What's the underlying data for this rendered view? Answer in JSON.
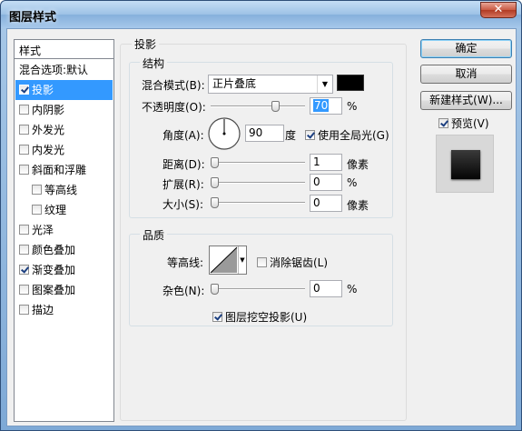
{
  "window": {
    "title": "图层样式",
    "close_glyph": "✕"
  },
  "sidebar": {
    "header": "样式",
    "items": [
      {
        "label": "混合选项:默认",
        "checkbox": false,
        "checked": false,
        "indent": false,
        "selected": false
      },
      {
        "label": "投影",
        "checkbox": true,
        "checked": true,
        "indent": false,
        "selected": true
      },
      {
        "label": "内阴影",
        "checkbox": true,
        "checked": false,
        "indent": false,
        "selected": false
      },
      {
        "label": "外发光",
        "checkbox": true,
        "checked": false,
        "indent": false,
        "selected": false
      },
      {
        "label": "内发光",
        "checkbox": true,
        "checked": false,
        "indent": false,
        "selected": false
      },
      {
        "label": "斜面和浮雕",
        "checkbox": true,
        "checked": false,
        "indent": false,
        "selected": false
      },
      {
        "label": "等高线",
        "checkbox": true,
        "checked": false,
        "indent": true,
        "selected": false
      },
      {
        "label": "纹理",
        "checkbox": true,
        "checked": false,
        "indent": true,
        "selected": false
      },
      {
        "label": "光泽",
        "checkbox": true,
        "checked": false,
        "indent": false,
        "selected": false
      },
      {
        "label": "颜色叠加",
        "checkbox": true,
        "checked": false,
        "indent": false,
        "selected": false
      },
      {
        "label": "渐变叠加",
        "checkbox": true,
        "checked": true,
        "indent": false,
        "selected": false
      },
      {
        "label": "图案叠加",
        "checkbox": true,
        "checked": false,
        "indent": false,
        "selected": false
      },
      {
        "label": "描边",
        "checkbox": true,
        "checked": false,
        "indent": false,
        "selected": false
      }
    ]
  },
  "shadow": {
    "group_label": "投影",
    "structure": {
      "label": "结构",
      "blend_mode_label": "混合模式(B):",
      "blend_mode_value": "正片叠底",
      "blend_color": "#000000",
      "opacity_label": "不透明度(O):",
      "opacity_value": "70",
      "opacity_unit": "%",
      "opacity_level": 0.7,
      "angle_label": "角度(A):",
      "angle_value": "90",
      "angle_unit": "度",
      "global_light_label": "使用全局光(G)",
      "global_light_checked": true,
      "distance_label": "距离(D):",
      "distance_value": "1",
      "distance_unit": "像素",
      "distance_level": 0.0,
      "spread_label": "扩展(R):",
      "spread_value": "0",
      "spread_unit": "%",
      "spread_level": 0.0,
      "size_label": "大小(S):",
      "size_value": "0",
      "size_unit": "像素",
      "size_level": 0.0
    },
    "quality": {
      "label": "品质",
      "contour_label": "等高线:",
      "antialias_label": "消除锯齿(L)",
      "antialias_checked": false,
      "noise_label": "杂色(N):",
      "noise_value": "0",
      "noise_unit": "%",
      "noise_level": 0.0
    },
    "knockout_label": "图层挖空投影(U)",
    "knockout_checked": true
  },
  "buttons": {
    "ok": "确定",
    "cancel": "取消",
    "new_style": "新建样式(W)..."
  },
  "preview": {
    "label": "预览(V)",
    "checked": true
  }
}
